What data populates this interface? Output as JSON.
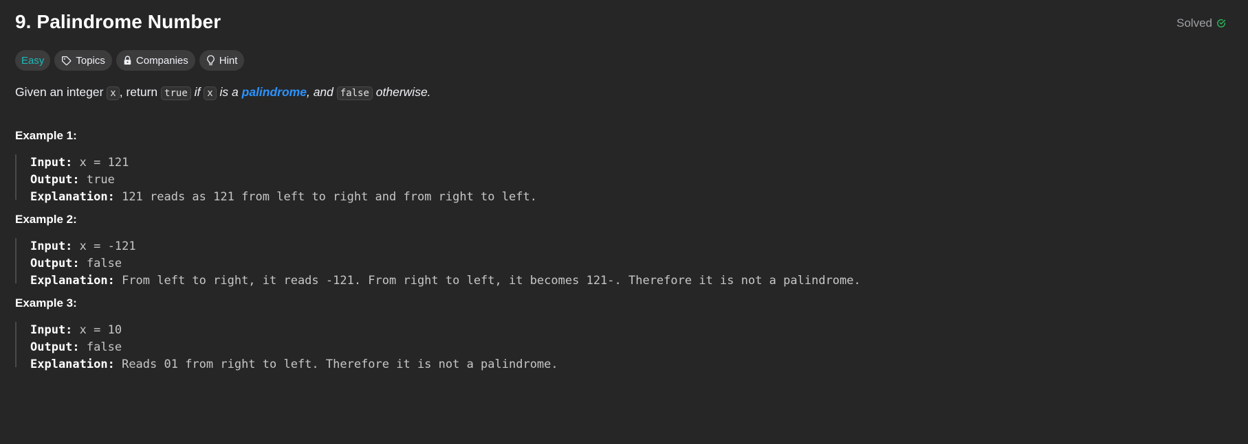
{
  "problem": {
    "title": "9. Palindrome Number",
    "status": "Solved"
  },
  "tags": {
    "difficulty": "Easy",
    "topics": "Topics",
    "companies": "Companies",
    "hint": "Hint"
  },
  "description": {
    "p1": "Given an integer ",
    "code_x": "x",
    "p2": ", return ",
    "code_true": "true",
    "p3": " if ",
    "code_x2": "x",
    "p4": " is a ",
    "link": "palindrome",
    "p5": ", and ",
    "code_false": "false",
    "p6": " otherwise."
  },
  "labels": {
    "input": "Input:",
    "output": "Output:",
    "explanation": "Explanation:"
  },
  "examples": [
    {
      "title": "Example 1:",
      "input": "x = 121",
      "output": "true",
      "explanation": "121 reads as 121 from left to right and from right to left."
    },
    {
      "title": "Example 2:",
      "input": "x = -121",
      "output": "false",
      "explanation": "From left to right, it reads -121. From right to left, it becomes 121-. Therefore it is not a palindrome."
    },
    {
      "title": "Example 3:",
      "input": "x = 10",
      "output": "false",
      "explanation": "Reads 01 from right to left. Therefore it is not a palindrome."
    }
  ],
  "colors": {
    "background": "#262626",
    "easy": "#1cbaba",
    "link": "#2b93ff",
    "solved_check": "#2cbb5d"
  }
}
